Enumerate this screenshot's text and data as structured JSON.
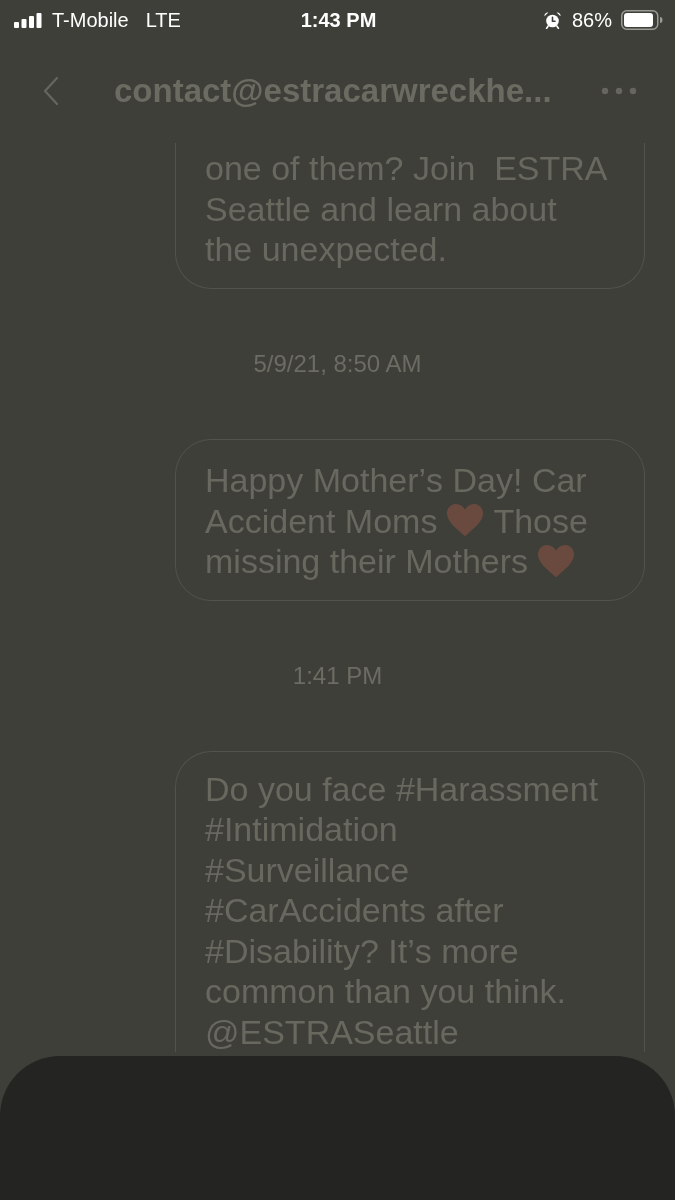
{
  "status_bar": {
    "carrier": "T-Mobile",
    "network": "LTE",
    "time": "1:43 PM",
    "battery": "86%"
  },
  "header": {
    "title": "contact@estracarwreckhe..."
  },
  "messages": [
    {
      "kind": "text",
      "text": "one of them? Join  ESTRA Seattle and learn about the unexpected."
    },
    {
      "kind": "timestamp",
      "text": "5/9/21, 8:50 AM"
    },
    {
      "kind": "lines",
      "lines": [
        [
          {
            "kind": "text",
            "text": "Happy Mother’s Day! Car"
          }
        ],
        [
          {
            "kind": "text",
            "text": "Accident Moms"
          },
          {
            "kind": "emoji"
          },
          {
            "kind": "text",
            "text": "Those"
          }
        ],
        [
          {
            "kind": "text",
            "text": "missing their Mothers"
          },
          {
            "kind": "emoji"
          }
        ]
      ]
    },
    {
      "kind": "timestamp",
      "text": "1:41 PM"
    },
    {
      "kind": "text",
      "text": "Do you face #Harassment #Intimidation #Surveillance #CarAccidents after #Disability? It’s more common than you think. @ESTRASeattle"
    }
  ]
}
